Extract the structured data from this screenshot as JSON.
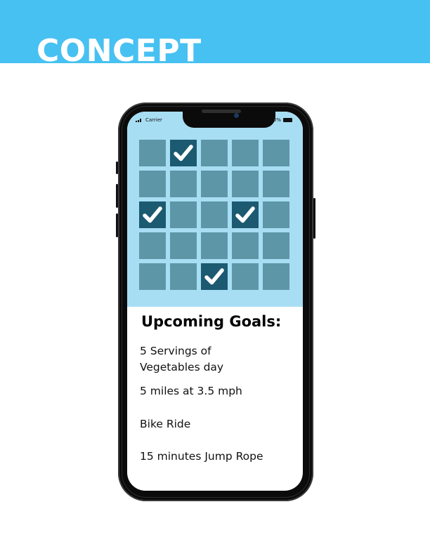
{
  "banner": {
    "title": "CONCEPT",
    "background": "#47c1f1"
  },
  "status_bar": {
    "carrier": "Carrier",
    "battery": "100%"
  },
  "habit_grid": {
    "rows": 5,
    "columns": 5,
    "cells": [
      [
        false,
        true,
        false,
        false,
        false
      ],
      [
        false,
        false,
        false,
        false,
        false
      ],
      [
        true,
        false,
        false,
        true,
        false
      ],
      [
        false,
        false,
        false,
        false,
        false
      ],
      [
        false,
        false,
        true,
        false,
        false
      ]
    ],
    "cell_color": "#5d97a7",
    "checked_color": "#1b5a70",
    "panel_color": "#a8def3"
  },
  "goals": {
    "title": "Upcoming Goals:",
    "items": [
      "5 Servings of Vegetables day",
      "5 miles at 3.5 mph",
      "Bike Ride",
      "15 minutes Jump Rope"
    ]
  }
}
